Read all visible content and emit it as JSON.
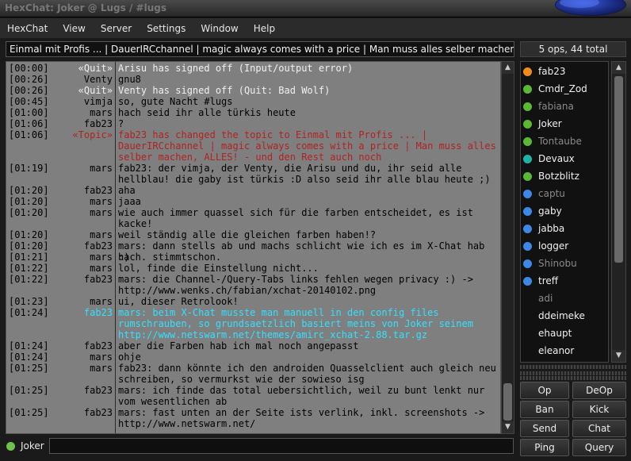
{
  "window": {
    "title": "HexChat: Joker @ Lugs / #lugs"
  },
  "menu": [
    "HexChat",
    "View",
    "Server",
    "Settings",
    "Window",
    "Help"
  ],
  "topic": "Einmal mit Profis ... | DauerIRCchannel | magic always comes with a price | Man muss alles selber machen, ALLES! - und den Rest auch noch",
  "userlist_header": "5 ops, 44 total",
  "messages": [
    {
      "time": "[00:00]",
      "nick": "«Quit»",
      "text": "Arisu has signed off (Input/output error)",
      "type": "sys"
    },
    {
      "time": "[00:26]",
      "nick": "Venty",
      "text": "gnu8",
      "type": "normal"
    },
    {
      "time": "[00:26]",
      "nick": "«Quit»",
      "text": "Venty has signed off (Quit: Bad Wolf)",
      "type": "sys"
    },
    {
      "time": "[00:45]",
      "nick": "vimja",
      "text": "so, gute Nacht #lugs",
      "type": "normal"
    },
    {
      "time": "[01:00]",
      "nick": "mars",
      "text": "hach seid ihr alle türkis heute",
      "type": "normal"
    },
    {
      "time": "[01:06]",
      "nick": "fab23",
      "text": "?",
      "type": "normal"
    },
    {
      "time": "[01:06]",
      "nick": "«Topic»",
      "text": "fab23 has changed the topic to Einmal mit Profis ... |\nDauerIRCchannel | magic always comes with a price | Man muss alles\nselber machen, ALLES! - und den Rest auch noch",
      "type": "topic"
    },
    {
      "time": "[01:19]",
      "nick": "mars",
      "text": "fab23: der vimja, der Venty, die Arisu und du, ihr seid alle\nhellblau! die gaby ist türkis :D also seid ihr alle blau heute ;)",
      "type": "normal"
    },
    {
      "time": "[01:20]",
      "nick": "fab23",
      "text": "aha",
      "type": "normal"
    },
    {
      "time": "[01:20]",
      "nick": "mars",
      "text": "jaaa",
      "type": "normal"
    },
    {
      "time": "[01:20]",
      "nick": "mars",
      "text": "wie auch immer quassel sich für die farben entscheidet, es ist\nkacke!",
      "type": "normal"
    },
    {
      "time": "[01:20]",
      "nick": "mars",
      "text": "weil ständig alle die gleichen farben haben!?",
      "type": "normal"
    },
    {
      "time": "[01:20]",
      "nick": "fab23",
      "text": "mars: dann stells ab und machs schlicht wie ich es im X-Chat hab :)",
      "type": "normal"
    },
    {
      "time": "[01:21]",
      "nick": "mars",
      "text": "hach. stimmtschon.",
      "type": "normal"
    },
    {
      "time": "[01:22]",
      "nick": "mars",
      "text": "lol, finde die Einstellung nicht...",
      "type": "normal"
    },
    {
      "time": "[01:22]",
      "nick": "fab23",
      "text": "mars: die Channel-/Query-Tabs links fehlen wegen privacy :) ->\nhttp://www.wenks.ch/fabian/xchat-20140102.png",
      "type": "normal"
    },
    {
      "time": "[01:23]",
      "nick": "mars",
      "text": "ui, dieser Retrolook!",
      "type": "normal"
    },
    {
      "time": "[01:24]",
      "nick": "fab23",
      "text": "mars: beim X-Chat musste man manuell in den config files\nrumschrauben, so grundsaetzlich basiert meins von Joker seinem\nhttp://www.netswarm.net/themes/amirc_xchat-2.88.tar.gz",
      "type": "hl"
    },
    {
      "time": "[01:24]",
      "nick": "fab23",
      "text": "aber die Farben hab ich mal noch angepasst",
      "type": "normal"
    },
    {
      "time": "[01:24]",
      "nick": "mars",
      "text": "ohje",
      "type": "normal"
    },
    {
      "time": "[01:25]",
      "nick": "mars",
      "text": "fab23: dann könnte ich den androiden Quasselclient auch gleich neu\nschreiben, so vermurkst wie der sowieso isg",
      "type": "normal"
    },
    {
      "time": "[01:25]",
      "nick": "fab23",
      "text": "mars: ich finde das total uebersichtlich, weil zu bunt lenkt nur\nvom wesentlichen ab",
      "type": "normal"
    },
    {
      "time": "[01:25]",
      "nick": "fab23",
      "text": "mars: fast unten an der Seite ists verlink, inkl. screenshots ->\nhttp://www.netswarm.net/",
      "type": "normal"
    }
  ],
  "users": [
    {
      "name": "fab23",
      "status": "#f08c1e",
      "color": "#f0f0f0"
    },
    {
      "name": "Cmdr_Zod",
      "status": "#5ab834",
      "color": "#f0f0f0"
    },
    {
      "name": "fabiana",
      "status": "#5ab834",
      "color": "#8a8a8a"
    },
    {
      "name": "Joker",
      "status": "#5ab834",
      "color": "#f0f0f0"
    },
    {
      "name": "Tontaube",
      "status": "#5ab834",
      "color": "#8a8a8a"
    },
    {
      "name": "Devaux",
      "status": "#1fb3a6",
      "color": "#f0f0f0"
    },
    {
      "name": "Botzblitz",
      "status": "#5ab834",
      "color": "#f0f0f0"
    },
    {
      "name": "captu",
      "status": "#3d88e6",
      "color": "#8a8a8a"
    },
    {
      "name": "gaby",
      "status": "#3d88e6",
      "color": "#f0f0f0"
    },
    {
      "name": "jabba",
      "status": "#3d88e6",
      "color": "#f0f0f0"
    },
    {
      "name": "logger",
      "status": "#3d88e6",
      "color": "#f0f0f0"
    },
    {
      "name": "Shinobu",
      "status": "#3d88e6",
      "color": "#8a8a8a"
    },
    {
      "name": "treff",
      "status": "#3d88e6",
      "color": "#f0f0f0"
    },
    {
      "name": "adi",
      "status": "",
      "color": "#8a8a8a"
    },
    {
      "name": "ddeimeke",
      "status": "",
      "color": "#f0f0f0"
    },
    {
      "name": "ehaupt",
      "status": "",
      "color": "#f0f0f0"
    },
    {
      "name": "eleanor",
      "status": "",
      "color": "#f0f0f0"
    }
  ],
  "buttons": [
    "Op",
    "DeOp",
    "Ban",
    "Kick",
    "Send",
    "Chat",
    "Ping",
    "Query"
  ],
  "input": {
    "nick": "Joker",
    "value": ""
  }
}
